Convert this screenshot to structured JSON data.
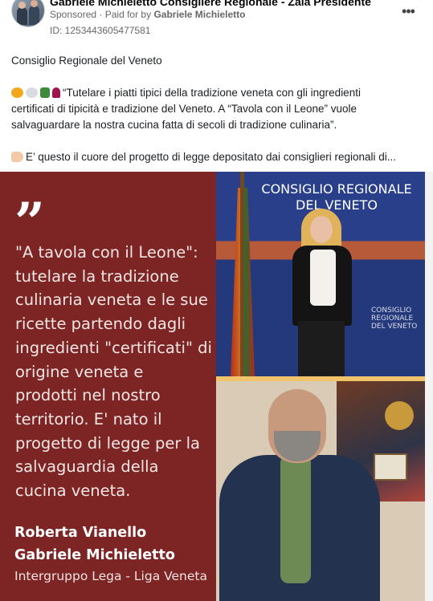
{
  "header": {
    "page_name": "Gabriele Michieletto Consigliere Regionale - Zaia Presidente",
    "sponsored_label": "Sponsored",
    "paid_for_prefix": "Paid for by",
    "payer": "Gabriele Michieletto",
    "ad_id": "ID: 1253443605477581",
    "more_glyph": "•••"
  },
  "body": {
    "line1": "Consiglio Regionale del Veneto",
    "line2": "“Tutelare i piatti tipici della tradizione veneta con gli ingredienti",
    "line3": "certificati di tipicità e tradizione del Veneto. A “Tavola con il Leone” vuole",
    "line4": "salvaguardare la nostra cucina fatta di secoli di tradizione culinaria”.",
    "line5": "E’ questo il cuore del progetto di legge depositato dai consiglieri regionali di..."
  },
  "creative": {
    "quote_mark": "”",
    "quote_text": "\"A tavola con il Leone\":\ntutelare la tradizione\nculinaria veneta e le sue\nricette partendo dagli\ningredienti \"certificati\" di\norigine veneta e\nprodotti nel nostro\nterritorio. E' nato il\nprogetto di legge per la\nsalvaguardia della\ncucina veneta.",
    "author1": "Roberta Vianello",
    "author2": "Gabriele Michieletto",
    "group": "Intergruppo Lega - Liga Veneta",
    "backdrop_title": "CONSIGLIO REGIONALE\nDEL VENETO",
    "backdrop_small": "CONSIGLIO\nREGIONALE\nDEL VENETO"
  },
  "colors": {
    "panel": "#7d2424",
    "accent_gold": "#f1c36b"
  }
}
